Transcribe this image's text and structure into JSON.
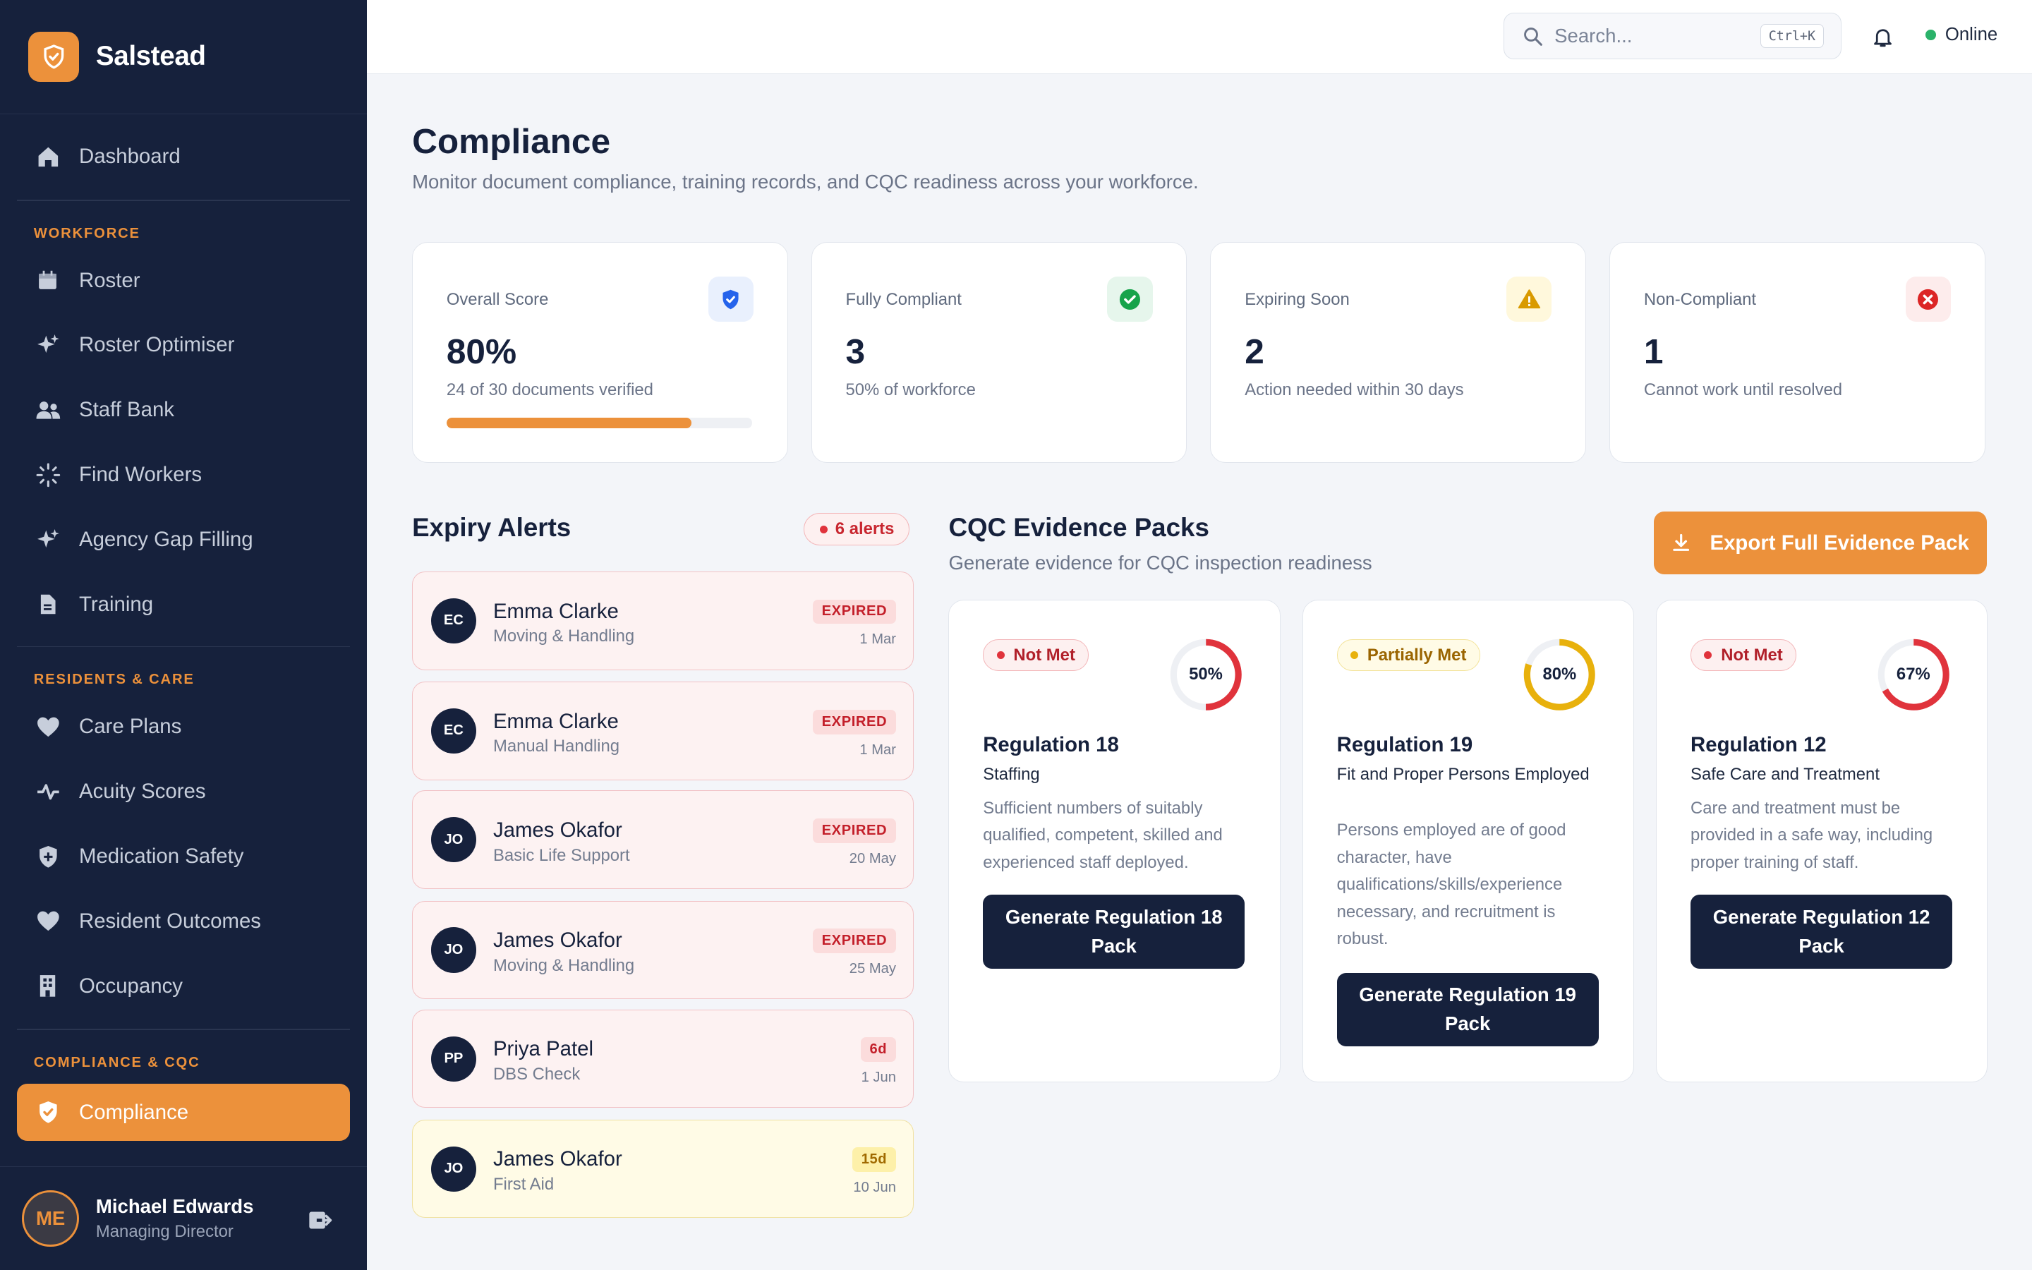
{
  "app": {
    "name": "Salstead"
  },
  "sidebar": {
    "dashboard": "Dashboard",
    "sections": {
      "workforce": "WORKFORCE",
      "residents": "RESIDENTS & CARE",
      "compliance": "COMPLIANCE & CQC"
    },
    "workforce_items": [
      "Roster",
      "Roster Optimiser",
      "Staff Bank",
      "Find Workers",
      "Agency Gap Filling",
      "Training"
    ],
    "residents_items": [
      "Care Plans",
      "Acuity Scores",
      "Medication Safety",
      "Resident Outcomes",
      "Occupancy"
    ],
    "compliance_items": [
      "Compliance"
    ]
  },
  "user": {
    "initials": "ME",
    "name": "Michael Edwards",
    "role": "Managing Director"
  },
  "topbar": {
    "search_placeholder": "Search...",
    "shortcut": "Ctrl+K",
    "status": "Online"
  },
  "page": {
    "title": "Compliance",
    "subtitle": "Monitor document compliance, training records, and CQC readiness across your workforce."
  },
  "stats": [
    {
      "label": "Overall Score",
      "value": "80%",
      "desc": "24 of 30 documents verified",
      "progress": 0.8
    },
    {
      "label": "Fully Compliant",
      "value": "3",
      "desc": "50% of workforce"
    },
    {
      "label": "Expiring Soon",
      "value": "2",
      "desc": "Action needed within 30 days"
    },
    {
      "label": "Non-Compliant",
      "value": "1",
      "desc": "Cannot work until resolved"
    }
  ],
  "expiry": {
    "title": "Expiry Alerts",
    "badge": "6 alerts",
    "items": [
      {
        "initials": "EC",
        "name": "Emma Clarke",
        "course": "Moving & Handling",
        "badge": "EXPIRED",
        "date": "1 Mar"
      },
      {
        "initials": "EC",
        "name": "Emma Clarke",
        "course": "Manual Handling",
        "badge": "EXPIRED",
        "date": "1 Mar"
      },
      {
        "initials": "JO",
        "name": "James Okafor",
        "course": "Basic Life Support",
        "badge": "EXPIRED",
        "date": "20 May"
      },
      {
        "initials": "JO",
        "name": "James Okafor",
        "course": "Moving & Handling",
        "badge": "EXPIRED",
        "date": "25 May"
      },
      {
        "initials": "PP",
        "name": "Priya Patel",
        "course": "DBS Check",
        "badge": "6d",
        "date": "1 Jun"
      },
      {
        "initials": "JO",
        "name": "James Okafor",
        "course": "First Aid",
        "badge": "15d",
        "date": "10 Jun"
      }
    ]
  },
  "cqc": {
    "title": "CQC Evidence Packs",
    "subtitle": "Generate evidence for CQC inspection readiness",
    "export_label": "Export Full Evidence Pack",
    "regs": [
      {
        "status": "Not Met",
        "percent": "50%",
        "fraction": 0.5,
        "color": "#e0333c",
        "title": "Regulation 18",
        "subtitle": "Staffing",
        "desc": "Sufficient numbers of suitably qualified, competent, skilled and experienced staff deployed.",
        "button": "Generate Regulation 18 Pack"
      },
      {
        "status": "Partially Met",
        "percent": "80%",
        "fraction": 0.8,
        "color": "#e8b10c",
        "title": "Regulation 19",
        "subtitle": "Fit and Proper Persons Employed",
        "desc": "Persons employed are of good character, have qualifications/skills/experience necessary, and recruitment is robust.",
        "button": "Generate Regulation 19 Pack"
      },
      {
        "status": "Not Met",
        "percent": "67%",
        "fraction": 0.67,
        "color": "#e0333c",
        "title": "Regulation 12",
        "subtitle": "Safe Care and Treatment",
        "desc": "Care and treatment must be provided in a safe way, including proper training of staff.",
        "button": "Generate Regulation 12 Pack"
      }
    ]
  }
}
